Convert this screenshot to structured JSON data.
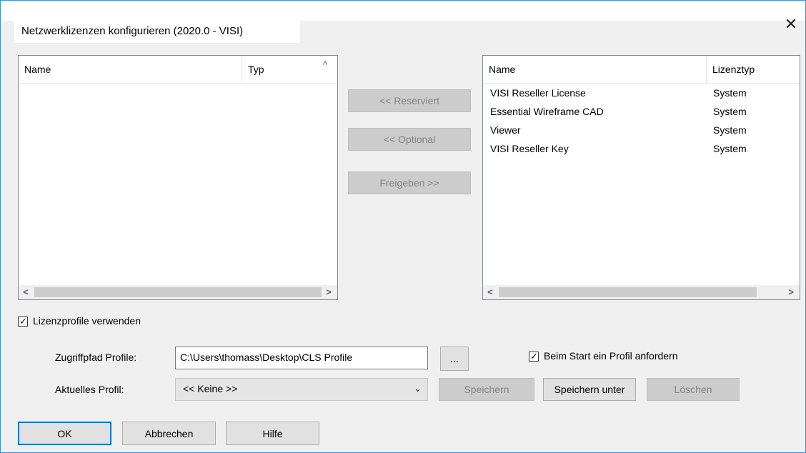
{
  "window": {
    "title": "Netzwerklizenzen konfigurieren (2020.0 - VISI)",
    "close_symbol": "✕"
  },
  "left_list": {
    "columns": [
      "Name",
      "Typ"
    ],
    "rows": []
  },
  "middle_buttons": {
    "reserved": "<< Reserviert",
    "optional": "<< Optional",
    "release": "Freigeben >>"
  },
  "right_list": {
    "columns": [
      "Name",
      "Lizenztyp"
    ],
    "rows": [
      {
        "name": "VISI Reseller License",
        "type": "System"
      },
      {
        "name": "Essential Wireframe CAD",
        "type": "System"
      },
      {
        "name": "Viewer",
        "type": "System"
      },
      {
        "name": "VISI Reseller Key",
        "type": "System"
      }
    ]
  },
  "use_profiles": {
    "label": "Lizenzprofile verwenden",
    "checked": true
  },
  "profile_path": {
    "label": "Zugriffpfad Profile:",
    "value": "C:\\Users\\thomass\\Desktop\\CLS Profile",
    "browse_label": "..."
  },
  "request_on_start": {
    "label": "Beim Start ein Profil anfordern",
    "checked": true
  },
  "current_profile": {
    "label": "Aktuelles Profil:",
    "selected": "<< Keine >>",
    "save": "Speichern",
    "save_as": "Speichern unter",
    "delete": "Löschen"
  },
  "footer": {
    "ok": "OK",
    "cancel": "Abbrechen",
    "help": "Hilfe"
  },
  "colors": {
    "accent": "#0078d7",
    "border": "#3c8fd8"
  }
}
